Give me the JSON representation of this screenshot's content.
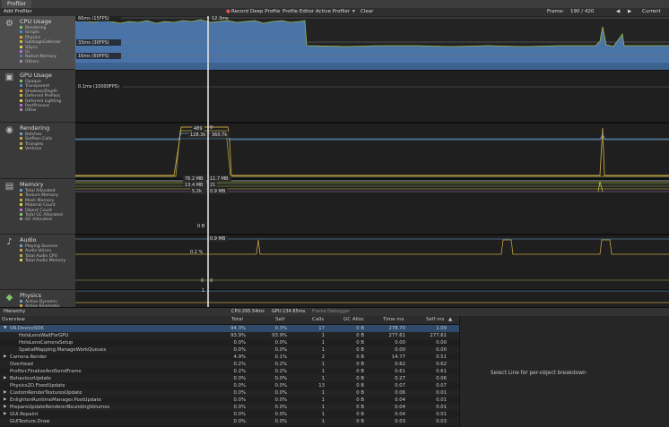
{
  "window": {
    "tab": "Profiler"
  },
  "toolbar": {
    "add_profiler": "Add Profiler",
    "record": "Record",
    "deep_profile": "Deep Profile",
    "profile_editor": "Profile Editor",
    "active_profiler": "Active Profiler",
    "clear": "Clear",
    "frame_label": "Frame:",
    "frame_value": "190 / 420",
    "current": "Current"
  },
  "categories": [
    {
      "name": "CPU Usage",
      "icon": "cpu-icon",
      "items": [
        {
          "label": "Rendering",
          "color": "#7fc36a"
        },
        {
          "label": "Scripts",
          "color": "#4c88c6"
        },
        {
          "label": "Physics",
          "color": "#e0a33a"
        },
        {
          "label": "GarbageCollector",
          "color": "#bcbc45"
        },
        {
          "label": "VSync",
          "color": "#e6d24a"
        },
        {
          "label": "Gi",
          "color": "#b073d6"
        },
        {
          "label": "Native Memory",
          "color": "#5a7ea8"
        },
        {
          "label": "Others",
          "color": "#a48aa5"
        }
      ]
    },
    {
      "name": "GPU Usage",
      "icon": "gpu-icon",
      "items": [
        {
          "label": "Opaque",
          "color": "#7fc36a"
        },
        {
          "label": "Transparent",
          "color": "#4c88c6"
        },
        {
          "label": "Shadows/Depth",
          "color": "#e0a33a"
        },
        {
          "label": "Deferred PrePass",
          "color": "#bcbc45"
        },
        {
          "label": "Deferred Lighting",
          "color": "#e6d24a"
        },
        {
          "label": "PostProcess",
          "color": "#b073d6"
        },
        {
          "label": "Other",
          "color": "#a48aa5"
        }
      ]
    },
    {
      "name": "Rendering",
      "icon": "rendering-icon",
      "items": [
        {
          "label": "Batches",
          "color": "#6ca0c6"
        },
        {
          "label": "SetPass Calls",
          "color": "#c9a043"
        },
        {
          "label": "Triangles",
          "color": "#b6b04a"
        },
        {
          "label": "Vertices",
          "color": "#d4d34c"
        }
      ]
    },
    {
      "name": "Memory",
      "icon": "memory-icon",
      "items": [
        {
          "label": "Total Allocated",
          "color": "#6ca0c6"
        },
        {
          "label": "Texture Memory",
          "color": "#c9a043"
        },
        {
          "label": "Mesh Memory",
          "color": "#b6b04a"
        },
        {
          "label": "Material Count",
          "color": "#d4d34c"
        },
        {
          "label": "Object Count",
          "color": "#b073d6"
        },
        {
          "label": "Total GC Allocated",
          "color": "#7fc36a"
        },
        {
          "label": "GC Allocated",
          "color": "#a48aa5"
        }
      ]
    },
    {
      "name": "Audio",
      "icon": "audio-icon",
      "items": [
        {
          "label": "Playing Sources",
          "color": "#6ca0c6"
        },
        {
          "label": "Audio Voices",
          "color": "#c9a043"
        },
        {
          "label": "Total Audio CPU",
          "color": "#b6b04a"
        },
        {
          "label": "Total Audio Memory",
          "color": "#d4d34c"
        }
      ]
    },
    {
      "name": "Physics",
      "icon": "physics-icon",
      "items": [
        {
          "label": "Active Dynamic",
          "color": "#6ca0c6"
        },
        {
          "label": "Active Kinematic",
          "color": "#c9a043"
        }
      ]
    }
  ],
  "graph_labels": {
    "cpu_66": "66ms (15FPS)",
    "cpu_33": "33ms (30FPS)",
    "cpu_16": "16ms (60FPS)",
    "cpu_top": "12.3ms",
    "gpu_01": "0.1ms (10000FPS)",
    "rendering_vals": [
      "489",
      "128.3k",
      "360.7k",
      "0"
    ],
    "memory_vals": [
      "76.2 MB",
      "11.7 MB",
      "13.4 MB",
      "21",
      "5.2k",
      "0.9 MB"
    ],
    "memory_zero": "0 B",
    "audio_vals": [
      "0.9 MB",
      "0.2 %"
    ],
    "audio_zero": "0",
    "audio_zero2": "0",
    "physics_val": "1"
  },
  "lower_tabs": {
    "hierarchy": "Hierarchy",
    "cpu": "CPU:295.54ms",
    "gpu": "GPU:134.85ms",
    "frame_debugger": "Frame Debugger"
  },
  "table": {
    "headers": [
      "Overview",
      "Total",
      "Self",
      "Calls",
      "GC Alloc",
      "Time ms",
      "Self ms"
    ],
    "rows": [
      {
        "name": "VR.DeviceSDK",
        "indent": 0,
        "arrow": "▼",
        "total": "94.3%",
        "self": "0.3%",
        "calls": "17",
        "gc": "0 B",
        "time": "278.70",
        "selfms": "1.09"
      },
      {
        "name": "HoloLensWaitForGPU",
        "indent": 1,
        "arrow": "",
        "total": "93.9%",
        "self": "93.9%",
        "calls": "1",
        "gc": "0 B",
        "time": "277.61",
        "selfms": "277.61"
      },
      {
        "name": "HoloLensCameraSetup",
        "indent": 1,
        "arrow": "",
        "total": "0.0%",
        "self": "0.0%",
        "calls": "1",
        "gc": "0 B",
        "time": "0.00",
        "selfms": "0.00"
      },
      {
        "name": "SpatialMapping.ManageWorkQueues",
        "indent": 1,
        "arrow": "",
        "total": "0.0%",
        "self": "0.0%",
        "calls": "1",
        "gc": "0 B",
        "time": "0.00",
        "selfms": "0.00"
      },
      {
        "name": "Camera.Render",
        "indent": 0,
        "arrow": "▶",
        "total": "4.9%",
        "self": "0.1%",
        "calls": "2",
        "gc": "0 B",
        "time": "14.77",
        "selfms": "0.51"
      },
      {
        "name": "Overhead",
        "indent": 0,
        "arrow": "",
        "total": "0.2%",
        "self": "0.2%",
        "calls": "1",
        "gc": "0 B",
        "time": "0.62",
        "selfms": "0.62"
      },
      {
        "name": "Profiler.FinalizeAndSendFrame",
        "indent": 0,
        "arrow": "",
        "total": "0.2%",
        "self": "0.2%",
        "calls": "1",
        "gc": "0 B",
        "time": "0.61",
        "selfms": "0.61"
      },
      {
        "name": "BehaviourUpdate",
        "indent": 0,
        "arrow": "▶",
        "total": "0.0%",
        "self": "0.0%",
        "calls": "1",
        "gc": "0 B",
        "time": "0.27",
        "selfms": "0.06"
      },
      {
        "name": "Physics2D.FixedUpdate",
        "indent": 0,
        "arrow": "",
        "total": "0.0%",
        "self": "0.0%",
        "calls": "13",
        "gc": "0 B",
        "time": "0.07",
        "selfms": "0.07"
      },
      {
        "name": "CustomRenderTexturesUpdate",
        "indent": 0,
        "arrow": "▶",
        "total": "0.0%",
        "self": "0.0%",
        "calls": "1",
        "gc": "0 B",
        "time": "0.06",
        "selfms": "0.01"
      },
      {
        "name": "EnlightenRuntimeManager.PostUpdate",
        "indent": 0,
        "arrow": "▶",
        "total": "0.0%",
        "self": "0.0%",
        "calls": "1",
        "gc": "0 B",
        "time": "0.04",
        "selfms": "0.01"
      },
      {
        "name": "PrepareUpdateRendererBoundingVolumes",
        "indent": 0,
        "arrow": "▶",
        "total": "0.0%",
        "self": "0.0%",
        "calls": "1",
        "gc": "0 B",
        "time": "0.04",
        "selfms": "0.01"
      },
      {
        "name": "GUI.Repaint",
        "indent": 0,
        "arrow": "▶",
        "total": "0.0%",
        "self": "0.0%",
        "calls": "1",
        "gc": "0 B",
        "time": "0.04",
        "selfms": "0.01"
      },
      {
        "name": "GUITexture.Draw",
        "indent": 0,
        "arrow": "",
        "total": "0.0%",
        "self": "0.0%",
        "calls": "1",
        "gc": "0 B",
        "time": "0.03",
        "selfms": "0.03"
      }
    ]
  },
  "right_pane": {
    "message": "Select Line for per-object breakdown"
  }
}
